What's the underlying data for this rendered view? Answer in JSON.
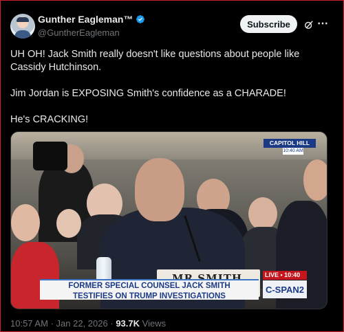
{
  "user": {
    "display_name": "Gunther Eagleman™",
    "handle": "@GuntherEagleman",
    "subscribe_label": "Subscribe"
  },
  "icons": {
    "verified": "verified-badge-icon",
    "grok": "grok-icon",
    "more": "more-options-icon"
  },
  "tweet": {
    "line1": "UH OH! Jack Smith really doesn't like questions about people like Cassidy Hutchinson.",
    "line2": "Jim Jordan is EXPOSING Smith's confidence as a CHARADE!",
    "line3": "He's CRACKING!"
  },
  "media": {
    "capitol_label": "CAPITOL HILL",
    "capitol_time": "10:40 AM",
    "nameplate": "MR SMITH",
    "lower_third_line1": "FORMER SPECIAL COUNSEL JACK SMITH",
    "lower_third_line2": "TESTIFIES ON TRUMP INVESTIGATIONS",
    "live_label": "LIVE • 10:40 ET",
    "network": "C-SPAN2"
  },
  "meta": {
    "time": "10:57 AM",
    "separator": "·",
    "date": "Jan 22, 2026",
    "views_count": "93.7K",
    "views_label": "Views"
  },
  "colors": {
    "accent_blue": "#1d9bf0",
    "background": "#000000",
    "border_red": "#d21f2d"
  }
}
